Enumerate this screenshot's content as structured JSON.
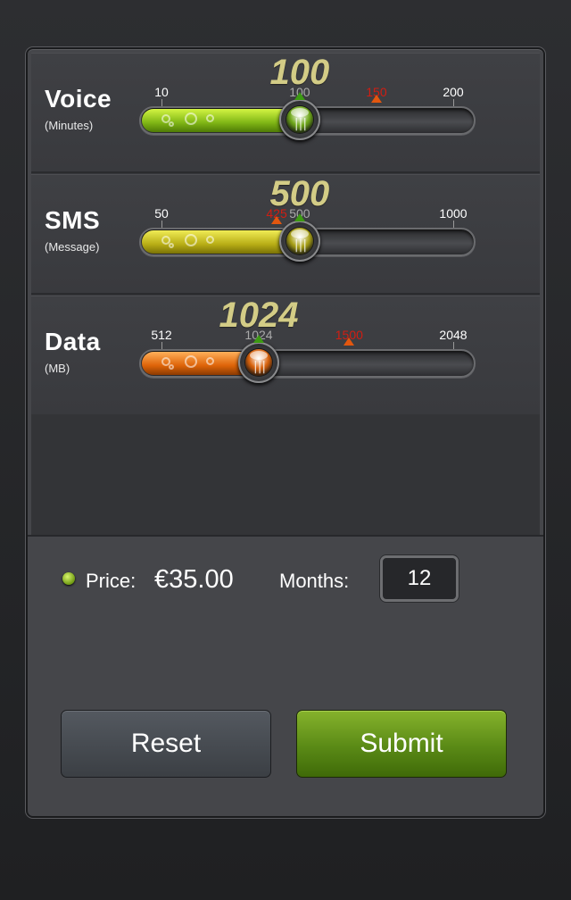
{
  "sliders": [
    {
      "label": "Voice",
      "unit": "(Minutes)",
      "value": "100",
      "min": "10",
      "mid": "100",
      "max": "200",
      "ref": "150",
      "value_num": 100,
      "min_num": 10,
      "max_num": 200,
      "ref_num": 150,
      "color": "green",
      "knob_color": "#6fa81a"
    },
    {
      "label": "SMS",
      "unit": "(Message)",
      "value": "500",
      "min": "50",
      "mid": "500",
      "max": "1000",
      "ref": "425",
      "value_num": 500,
      "min_num": 50,
      "max_num": 1000,
      "ref_num": 425,
      "color": "yellow",
      "knob_color": "#a8a017"
    },
    {
      "label": "Data",
      "unit": "(MB)",
      "value": "1024",
      "min": "512",
      "mid": "1024",
      "max": "2048",
      "ref": "1500",
      "value_num": 1024,
      "min_num": 512,
      "max_num": 2048,
      "ref_num": 1500,
      "color": "orange",
      "knob_color": "#d8620c"
    }
  ],
  "price": {
    "label": "Price:",
    "value": "€35.00"
  },
  "months": {
    "label": "Months:",
    "value": "12"
  },
  "buttons": {
    "reset": "Reset",
    "submit": "Submit"
  },
  "colors": {
    "accent_green": "#6f9a12",
    "reference_marker": "#e2570f",
    "reference_text": "#d21d12"
  }
}
